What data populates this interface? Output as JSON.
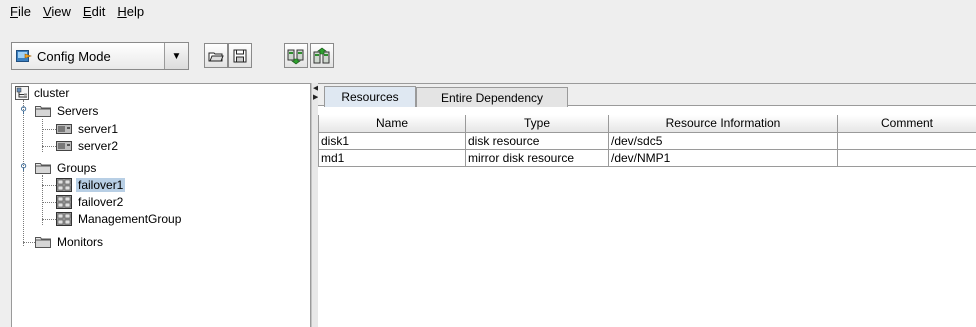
{
  "menu": [
    {
      "mnemonic": "F",
      "rest": "ile"
    },
    {
      "mnemonic": "V",
      "rest": "iew"
    },
    {
      "mnemonic": "E",
      "rest": "dit"
    },
    {
      "mnemonic": "H",
      "rest": "elp"
    }
  ],
  "toolbar": {
    "mode_selected": "Config Mode",
    "mode_icon": "config-mode-icon",
    "buttons": [
      "open-folder-icon",
      "save-disk-icon",
      "download-config-icon",
      "upload-config-icon"
    ]
  },
  "tree": {
    "root": "cluster",
    "servers_label": "Servers",
    "servers": [
      "server1",
      "server2"
    ],
    "groups_label": "Groups",
    "groups": [
      "failover1",
      "failover2",
      "ManagementGroup"
    ],
    "monitors_label": "Monitors",
    "selected": "failover1"
  },
  "tabs": [
    "Resources",
    "Entire Dependency"
  ],
  "active_tab": "Resources",
  "table": {
    "headers": [
      "Name",
      "Type",
      "Resource Information",
      "Comment"
    ],
    "rows": [
      [
        "disk1",
        "disk resource",
        "/dev/sdc5",
        ""
      ],
      [
        "md1",
        "mirror disk resource",
        "/dev/NMP1",
        ""
      ]
    ]
  },
  "colors": {
    "selection": "#b8cfe5",
    "active_tab": "#dfe8f2",
    "expander": "#2b5e8e"
  }
}
